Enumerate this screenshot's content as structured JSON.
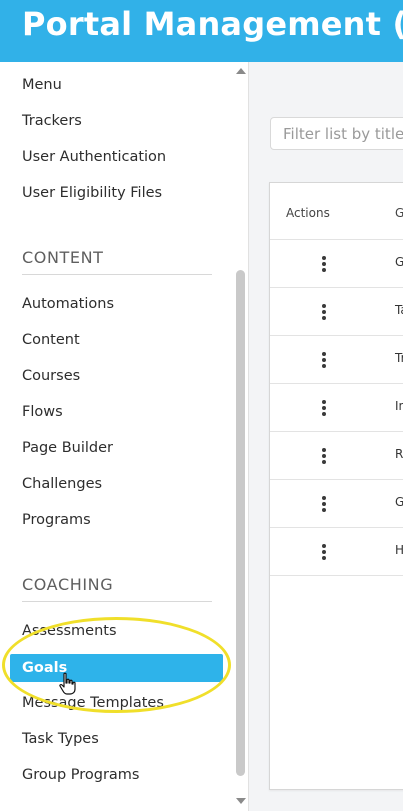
{
  "header": {
    "title": "Portal Management (W"
  },
  "sidebar": {
    "top_items": [
      "Menu",
      "Trackers",
      "User Authentication",
      "User Eligibility Files"
    ],
    "sections": [
      {
        "heading": "CONTENT",
        "items": [
          "Automations",
          "Content",
          "Courses",
          "Flows",
          "Page Builder",
          "Challenges",
          "Programs"
        ]
      },
      {
        "heading": "COACHING",
        "items": [
          "Assessments",
          "Goals",
          "Message Templates",
          "Task Types",
          "Group Programs"
        ]
      }
    ],
    "active_item": "Goals"
  },
  "main": {
    "filter_placeholder": "Filter list by title",
    "table": {
      "columns": [
        "Actions",
        "G"
      ],
      "rows": [
        {
          "action_icon": "more-vertical-icon",
          "cell": "G"
        },
        {
          "action_icon": "more-vertical-icon",
          "cell": "Ta"
        },
        {
          "action_icon": "more-vertical-icon",
          "cell": "Tr"
        },
        {
          "action_icon": "more-vertical-icon",
          "cell": "In"
        },
        {
          "action_icon": "more-vertical-icon",
          "cell": "R"
        },
        {
          "action_icon": "more-vertical-icon",
          "cell": "G"
        },
        {
          "action_icon": "more-vertical-icon",
          "cell": "H"
        }
      ]
    }
  },
  "colors": {
    "brand_blue": "#31b1e8",
    "active_item_bg": "#2eb3ea",
    "annotation_yellow": "#f0df2a"
  }
}
